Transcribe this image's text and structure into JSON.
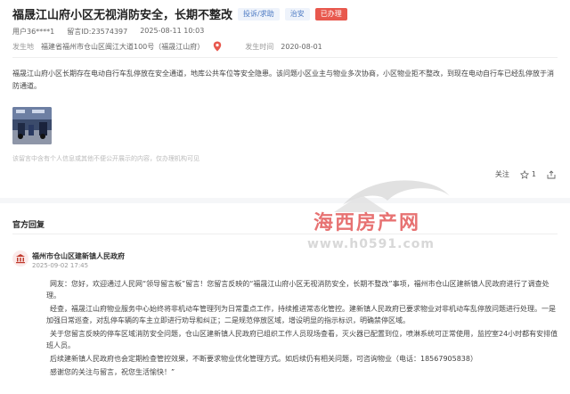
{
  "header": {
    "title": "福晟江山府小区无视消防安全，长期不整改",
    "tags": [
      "投诉/求助",
      "治安",
      "已办理"
    ]
  },
  "meta": {
    "user": "用户36****1",
    "message_id": "留言ID:23574397",
    "posted_time": "2025-08-11 10:03",
    "location_label": "发生地",
    "location": "福建省福州市仓山区闽江大道100号（福晟江山府）",
    "date_label": "发生时间",
    "date": "2020-08-01"
  },
  "body": {
    "content": "福晟江山府小区长期存在电动自行车乱停放在安全通道，地库公共车位等安全隐患。该问题小区业主与物业多次协商，小区物业拒不整改，到现在电动自行车已经乱停放于消防通道。",
    "disclaimer": "该留言中含有个人信息或其他不便公开展示的内容，仅办理机构可见"
  },
  "actions": {
    "follow": "关注",
    "like_count": "1"
  },
  "reply_section": {
    "title": "官方回复",
    "org_name": "福州市仓山区建新镇人民政府",
    "date": "2025-09-02 17:45",
    "paragraphs": [
      "网友：您好，欢迎通过人民网“领导留言板”留言！您留言反映的“福晟江山府小区无视消防安全，长期不整改”事项，福州市仓山区建新镇人民政府进行了调查处理。",
      "经查，福晟江山府物业服务中心始终将非机动车管理列为日常重点工作，持续推进常态化管控。建新镇人民政府已要求物业对非机动车乱停放问题进行处理。一是加强日常巡查，对乱停车辆的车主立即进行劝导和纠正；二是规范停放区域，增设明显的指示标识，明确禁停区域。",
      "关于您留言反映的停车区域消防安全问题，仓山区建新镇人民政府已组织工作人员现场查看，灭火器已配置到位，喷淋系统可正常使用，监控室24小时都有安排值班人员。",
      "后续建新镇人民政府也会定期检查管控效果，不断要求物业优化管理方式。如后续仍有相关问题，可咨询物业（电话：18567905838）",
      "感谢您的关注与留言，祝您生活愉快！”"
    ]
  },
  "watermark": {
    "title": "海西房产网",
    "url": "www.h0591.com"
  },
  "colors": {
    "tag_blue_bg": "#eef3fb",
    "tag_blue_fg": "#4a78c2",
    "tag_red_bg": "#e8584d",
    "watermark_red": "#e35a5a"
  }
}
